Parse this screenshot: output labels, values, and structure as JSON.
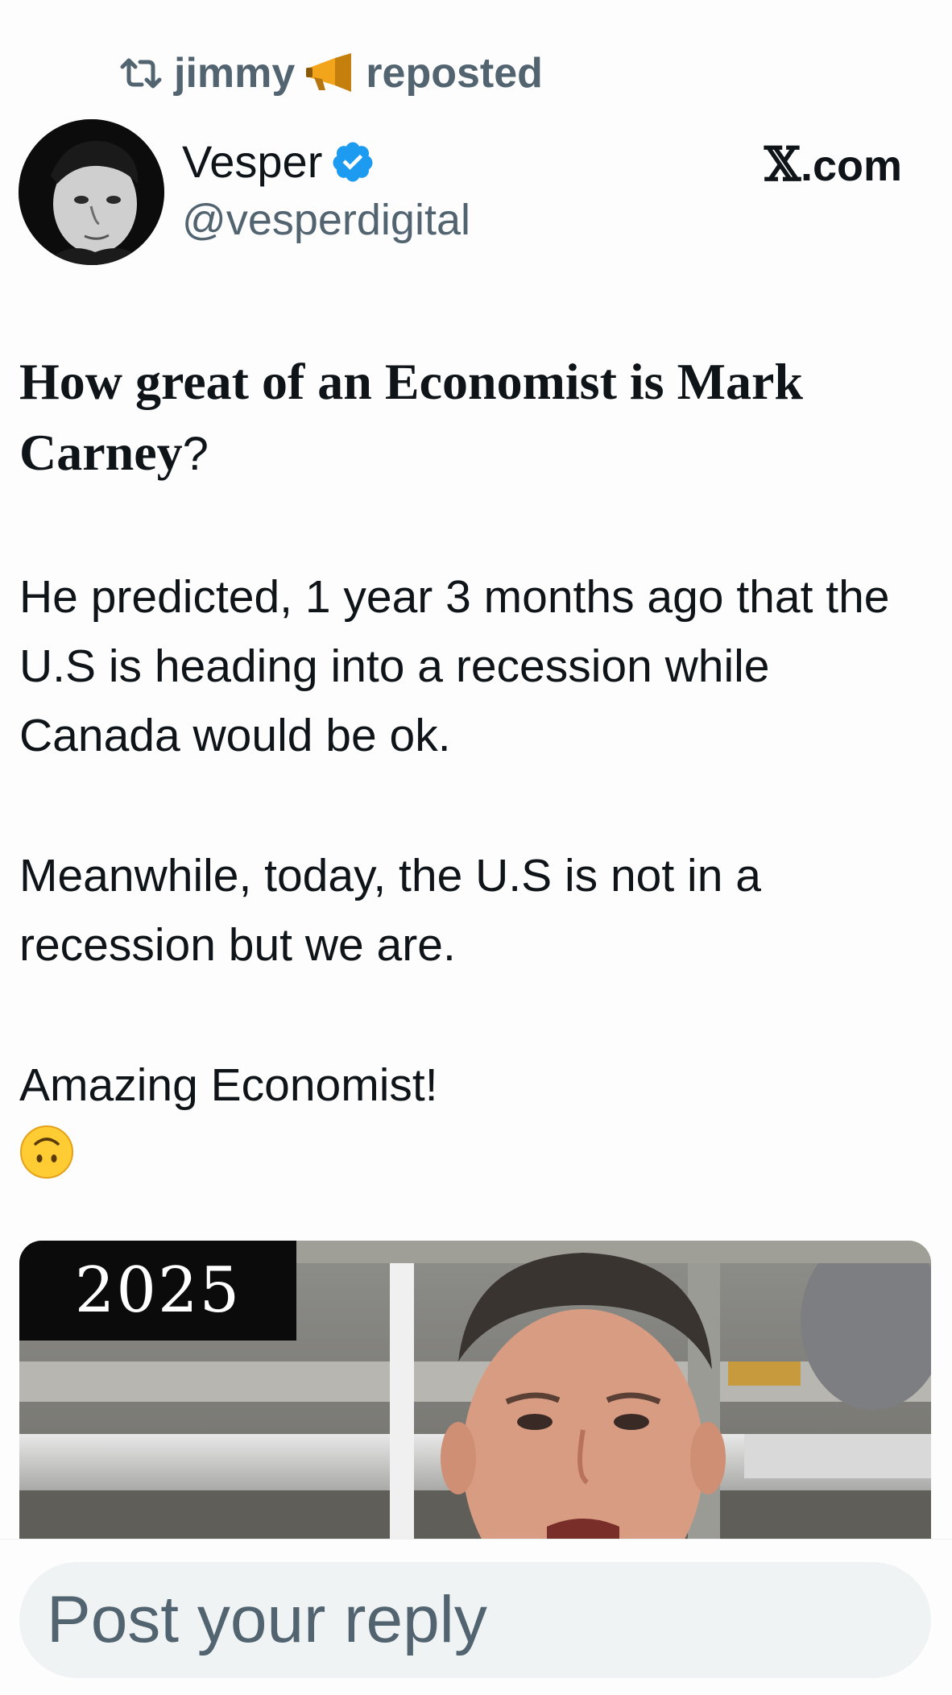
{
  "repost": {
    "user": "jimmy",
    "label": "reposted",
    "icons": [
      "repost-icon",
      "megaphone-emoji"
    ]
  },
  "author": {
    "name": "Vesper",
    "handle": "@vesperdigital",
    "verified": true,
    "verified_color": "#1d9bf0"
  },
  "source": {
    "x_glyph": "𝕏",
    "domain_suffix": ".com"
  },
  "post": {
    "headline_main": "How great of an Economist is Mark Carney",
    "headline_punct": "?",
    "paragraphs": [
      "He predicted, 1 year 3 months ago that the U.S is heading into a recession while Canada would be ok.",
      "Meanwhile, today, the U.S is not in a recession but we are.",
      "Amazing Economist!"
    ],
    "emoji": "upside-down-face-emoji"
  },
  "media": {
    "label": "2025"
  },
  "reply": {
    "placeholder": "Post your reply"
  },
  "colors": {
    "text": "#0f1419",
    "secondary": "#536471",
    "reply_bg": "#eff3f4"
  }
}
